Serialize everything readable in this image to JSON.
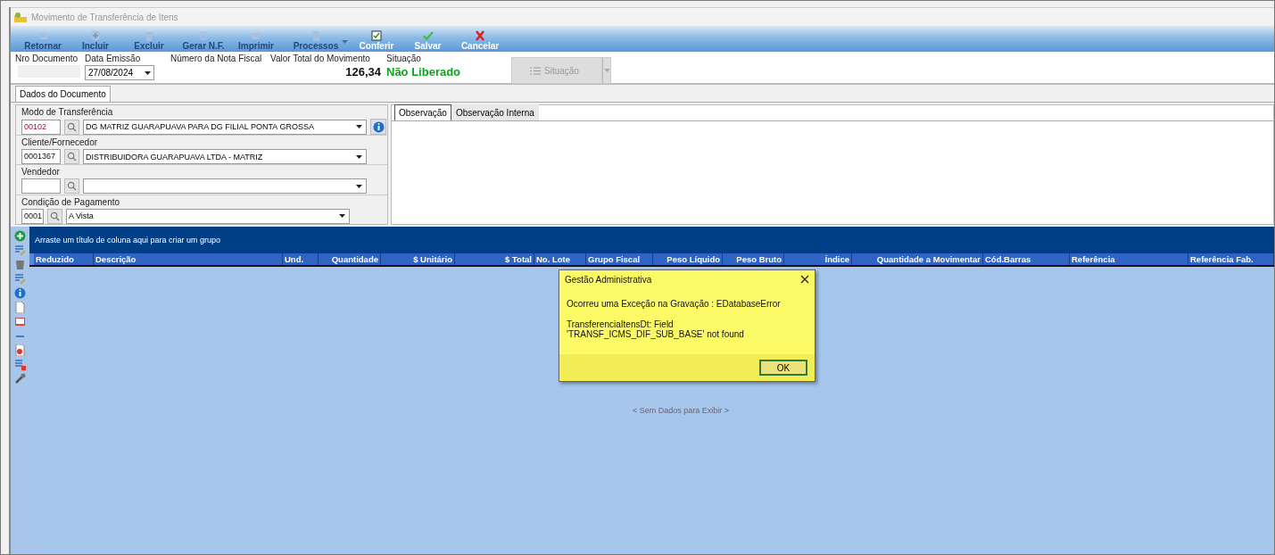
{
  "window": {
    "title": "Movimento de Transferência de Itens"
  },
  "toolbar": [
    {
      "label": "Retornar",
      "disabled": true,
      "kind": "return"
    },
    {
      "label": "Incluir",
      "disabled": true,
      "kind": "add"
    },
    {
      "label": "Excluir",
      "disabled": true,
      "kind": "delete"
    },
    {
      "label": "Gerar N.F.",
      "disabled": true,
      "kind": "gear"
    },
    {
      "label": "Imprimir",
      "disabled": true,
      "kind": "print"
    },
    {
      "label": "Processos",
      "disabled": true,
      "kind": "process",
      "dropdown": true
    },
    {
      "label": "Conferir",
      "disabled": false,
      "kind": "check"
    },
    {
      "label": "Salvar",
      "disabled": false,
      "kind": "save"
    },
    {
      "label": "Cancelar",
      "disabled": false,
      "kind": "cancel"
    }
  ],
  "header": {
    "nro_documento": {
      "label": "Nro Documento"
    },
    "data_emissao": {
      "label": "Data Emissão",
      "value": "27/08/2024"
    },
    "numero_nf": {
      "label": "Número da Nota Fiscal"
    },
    "valor_total": {
      "label": "Valor Total do Movimento",
      "value": "126,34"
    },
    "situacao": {
      "label": "Situação",
      "value": "Não Liberado"
    },
    "situacao_button": {
      "label": "Situação",
      "disabled": true
    }
  },
  "tabs": [
    {
      "label": "Dados do Documento",
      "selected": true
    }
  ],
  "fields": [
    {
      "label": "Modo de Transferência",
      "code": "00102",
      "value": "DG MATRIZ GUARAPUAVA PARA DG FILIAL PONTA GROSSA",
      "info": true
    },
    {
      "label": "Cliente/Fornecedor",
      "code": "0001367",
      "value": "DISTRIBUIDORA GUARAPUAVA LTDA - MATRIZ",
      "info": false
    },
    {
      "label": "Vendedor",
      "info": false
    },
    {
      "label": "Condição de Pagamento",
      "code": "0001",
      "value": "A Vista",
      "info": false
    }
  ],
  "obs_tabs": [
    {
      "label": "Observação",
      "selected": true
    },
    {
      "label": "Observação Interna",
      "selected": false
    }
  ],
  "grid": {
    "group_hint": "Arraste um título de coluna aqui para criar um grupo",
    "columns": [
      "Reduzido",
      "Descrição",
      "Und.",
      "Quantidade",
      "$ Unitário",
      "$ Total",
      "No. Lote",
      "Grupo Fiscal",
      "Peso Líquido",
      "Peso Bruto",
      "Índice",
      "Quantidade a Movimentar",
      "Cód.Barras",
      "Referência",
      "Referência Fab."
    ],
    "empty_text": "< Sem Dados para Exibir >"
  },
  "side_tools": [
    {
      "kind": "add"
    },
    {
      "kind": "edit"
    },
    {
      "kind": "trash"
    },
    {
      "kind": "edit"
    },
    {
      "kind": "info"
    },
    {
      "kind": "doc"
    },
    {
      "kind": "book"
    },
    {
      "kind": "minus"
    },
    {
      "kind": "pdf"
    },
    {
      "kind": "grid"
    },
    {
      "kind": "wrench"
    }
  ],
  "dialog": {
    "title": "Gestão Administrativa",
    "message": "Ocorreu uma Exceção na Gravação : EDatabaseError",
    "detail": "TransferenciaItensDt: Field 'TRANSF_ICMS_DIF_SUB_BASE' not found",
    "button": "OK"
  }
}
